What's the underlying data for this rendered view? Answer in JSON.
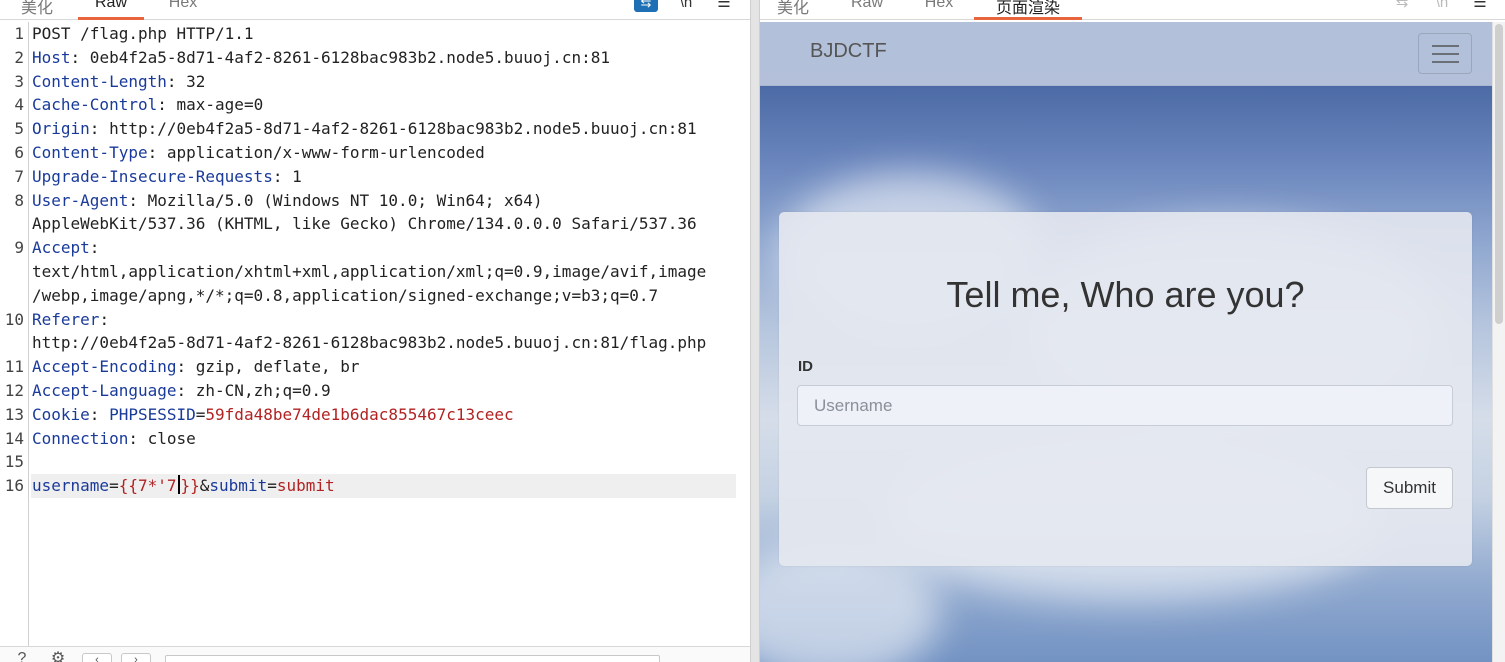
{
  "request_panel": {
    "tabs": [
      {
        "label": "美化",
        "active": false
      },
      {
        "label": "Raw",
        "active": true
      },
      {
        "label": "Hex",
        "active": false
      }
    ],
    "toolbar_icons": [
      "wrap-toggle-icon",
      "newline-icon",
      "menu-icon"
    ],
    "line_numbers": [
      "1",
      "2",
      "3",
      "4",
      "5",
      "6",
      "7",
      "8",
      "9",
      "10",
      "11",
      "12",
      "13",
      "14",
      "15",
      "16"
    ],
    "lines": {
      "l1": "POST /flag.php HTTP/1.1",
      "l2": {
        "key": "Host",
        "value": " 0eb4f2a5-8d71-4af2-8261-6128bac983b2.node5.buuoj.cn:81"
      },
      "l3": {
        "key": "Content-Length",
        "value": " 32"
      },
      "l4": {
        "key": "Cache-Control",
        "value": " max-age=0"
      },
      "l5": {
        "key": "Origin",
        "value": " http://0eb4f2a5-8d71-4af2-8261-6128bac983b2.node5.buuoj.cn:81"
      },
      "l6": {
        "key": "Content-Type",
        "value": " application/x-www-form-urlencoded"
      },
      "l7": {
        "key": "Upgrade-Insecure-Requests",
        "value": " 1"
      },
      "l8": {
        "key": "User-Agent",
        "value": " Mozilla/5.0 (Windows NT 10.0; Win64; x64)",
        "cont": "AppleWebKit/537.36 (KHTML, like Gecko) Chrome/134.0.0.0 Safari/537.36"
      },
      "l9": {
        "key": "Accept",
        "cont1": "text/html,application/xhtml+xml,application/xml;q=0.9,image/avif,image",
        "cont2": "/webp,image/apng,*/*;q=0.8,application/signed-exchange;v=b3;q=0.7"
      },
      "l10": {
        "key": "Referer",
        "cont": "http://0eb4f2a5-8d71-4af2-8261-6128bac983b2.node5.buuoj.cn:81/flag.php"
      },
      "l11": {
        "key": "Accept-Encoding",
        "value": " gzip, deflate, br"
      },
      "l12": {
        "key": "Accept-Language",
        "value": " zh-CN,zh;q=0.9"
      },
      "l13": {
        "key": "Cookie",
        "cookie_name": "PHPSESSID",
        "cookie_value": "59fda48be74de1b6dac855467c13ceec"
      },
      "l14": {
        "key": "Connection",
        "value": " close"
      },
      "l16": {
        "param1": "username",
        "value1_a": "{{7*'7",
        "value1_b": "}}",
        "amp": "&",
        "param2": "submit",
        "value2": "submit"
      }
    },
    "bottom_icons": [
      "help-icon",
      "settings-icon",
      "back-icon",
      "forward-icon"
    ]
  },
  "render_panel": {
    "tabs": [
      {
        "label": "美化",
        "active": false
      },
      {
        "label": "Raw",
        "active": false
      },
      {
        "label": "Hex",
        "active": false
      },
      {
        "label": "页面渲染",
        "active": true
      }
    ],
    "page": {
      "brand": "BJDCTF",
      "heading": "Tell me, Who are you?",
      "id_label": "ID",
      "username_placeholder": "Username",
      "submit_label": "Submit"
    }
  }
}
